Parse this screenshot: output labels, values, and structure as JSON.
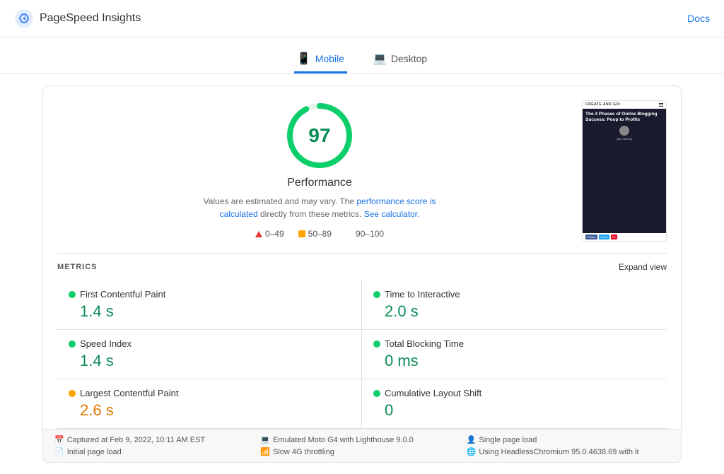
{
  "header": {
    "logo_text": "PageSpeed Insights",
    "docs_label": "Docs"
  },
  "tabs": [
    {
      "id": "mobile",
      "label": "Mobile",
      "active": true,
      "icon": "📱"
    },
    {
      "id": "desktop",
      "label": "Desktop",
      "active": false,
      "icon": "💻"
    }
  ],
  "score": {
    "value": "97",
    "label": "Performance",
    "ring_color": "#0cce6b",
    "ring_bg": "#e0f5eb"
  },
  "description": {
    "line1": "Values are estimated and may vary. The",
    "link_text": "performance score is calculated",
    "line2": "directly from these metrics.",
    "see_calc": "See calculator."
  },
  "legend": [
    {
      "label": "0–49",
      "color": "red",
      "type": "triangle"
    },
    {
      "label": "50–89",
      "color": "#ffa400",
      "type": "square"
    },
    {
      "label": "90–100",
      "color": "#0cce6b",
      "type": "circle"
    }
  ],
  "screenshot": {
    "site_name": "CREATE AND GO•",
    "title": "The 4 Phases of Online Blogging Success: Poop to Profits"
  },
  "metrics": {
    "title": "METRICS",
    "expand_label": "Expand view",
    "items": [
      {
        "id": "fcp",
        "label": "First Contentful Paint",
        "value": "1.4 s",
        "color": "green"
      },
      {
        "id": "tti",
        "label": "Time to Interactive",
        "value": "2.0 s",
        "color": "green"
      },
      {
        "id": "si",
        "label": "Speed Index",
        "value": "1.4 s",
        "color": "green"
      },
      {
        "id": "tbt",
        "label": "Total Blocking Time",
        "value": "0 ms",
        "color": "green"
      },
      {
        "id": "lcp",
        "label": "Largest Contentful Paint",
        "value": "2.6 s",
        "color": "orange"
      },
      {
        "id": "cls",
        "label": "Cumulative Layout Shift",
        "value": "0",
        "color": "green"
      }
    ]
  },
  "footer": {
    "col1": [
      {
        "icon": "📅",
        "text": "Captured at Feb 9, 2022, 10:11 AM EST"
      },
      {
        "icon": "📄",
        "text": "Initial page load"
      }
    ],
    "col2": [
      {
        "icon": "💻",
        "text": "Emulated Moto G4 with Lighthouse 9.0.0"
      },
      {
        "icon": "📶",
        "text": "Slow 4G throttling"
      }
    ],
    "col3": [
      {
        "icon": "👤",
        "text": "Single page load"
      },
      {
        "icon": "🌐",
        "text": "Using HeadlessChromium 95.0.4638.69 with lr"
      }
    ]
  }
}
